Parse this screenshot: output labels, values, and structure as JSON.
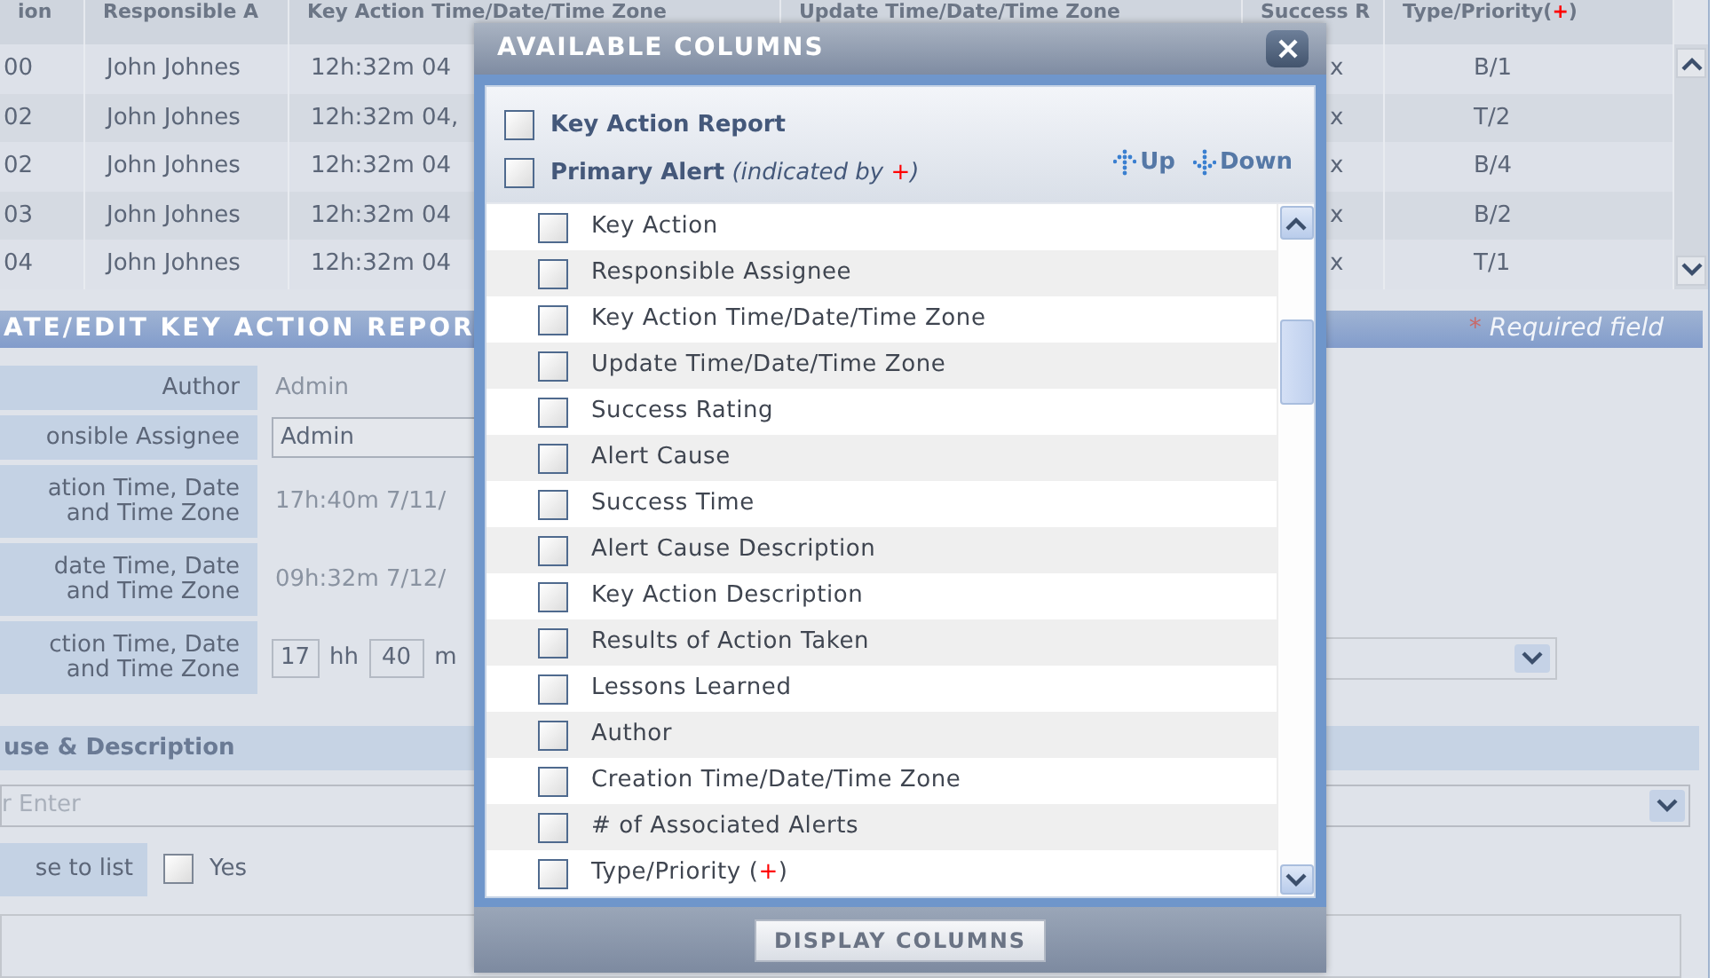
{
  "table": {
    "columns": [
      {
        "parts": [
          {
            "text": "ion"
          }
        ]
      },
      {
        "parts": [
          {
            "text": "Responsible A"
          }
        ]
      },
      {
        "parts": [
          {
            "text": "Key Action Time/Date/Time Zone"
          }
        ]
      },
      {
        "parts": [
          {
            "text": "Update Time/Date/Time Zone"
          }
        ]
      },
      {
        "parts": [
          {
            "text": "Success R"
          }
        ]
      },
      {
        "parts": [
          {
            "text": "Type/Priority("
          },
          {
            "text": "+",
            "color": "#ff0000"
          },
          {
            "text": ")"
          }
        ]
      }
    ],
    "rows": [
      {
        "cells": [
          "00",
          "John Johnes",
          "12h:32m 04",
          "",
          "x",
          "B/1"
        ]
      },
      {
        "cells": [
          "02",
          "John Johnes",
          "12h:32m 04,",
          "",
          "x",
          "T/2"
        ]
      },
      {
        "cells": [
          "02",
          "John Johnes",
          "12h:32m 04",
          "",
          "x",
          "B/4"
        ]
      },
      {
        "cells": [
          "03",
          "John Johnes",
          "12h:32m 04",
          "",
          "x",
          "B/2"
        ]
      },
      {
        "cells": [
          "04",
          "John Johnes",
          "12h:32m 04",
          "",
          "x",
          "T/1"
        ]
      }
    ]
  },
  "form": {
    "title": "ATE/EDIT KEY ACTION REPOR",
    "required_note": {
      "mark": "*",
      "text": "Required field"
    },
    "fields": [
      {
        "kind": "readonly",
        "label": "Author",
        "value": "Admin"
      },
      {
        "kind": "input",
        "label": "onsible Assignee",
        "value": "Admin"
      },
      {
        "kind": "readonly",
        "label": "ation Time, Date and Time Zone",
        "value": "17h:40m 7/11/"
      },
      {
        "kind": "readonly",
        "label": "date Time, Date and Time Zone",
        "value": "09h:32m 7/12/"
      },
      {
        "kind": "time",
        "label": "ction Time, Date and Time Zone",
        "hours": "17",
        "hours_unit": "hh",
        "minutes": "40",
        "minutes_unit": "m"
      }
    ],
    "section": "use & Description",
    "cause": {
      "placeholder": "r Enter"
    },
    "add_to_list": {
      "label": "se to list",
      "option": "Yes",
      "checked": false
    }
  },
  "dialog": {
    "title": "AVAILABLE COLUMNS",
    "groups": [
      {
        "checked": false,
        "parts": [
          {
            "text": "Key Action Report",
            "kind": "name"
          }
        ]
      },
      {
        "checked": false,
        "parts": [
          {
            "text": "Primary Alert",
            "kind": "name"
          },
          {
            "text": " (indicated by ",
            "kind": "note"
          },
          {
            "text": "+",
            "kind": "note",
            "color": "#ff0000"
          },
          {
            "text": ")",
            "kind": "note"
          }
        ]
      }
    ],
    "move_buttons": [
      {
        "kind": "up",
        "label": "Up"
      },
      {
        "kind": "down",
        "label": "Down"
      }
    ],
    "columns": [
      {
        "checked": false,
        "parts": [
          {
            "text": "Key Action"
          }
        ]
      },
      {
        "checked": false,
        "parts": [
          {
            "text": "Responsible Assignee"
          }
        ]
      },
      {
        "checked": false,
        "parts": [
          {
            "text": "Key Action Time/Date/Time Zone"
          }
        ]
      },
      {
        "checked": false,
        "parts": [
          {
            "text": "Update Time/Date/Time Zone"
          }
        ]
      },
      {
        "checked": false,
        "parts": [
          {
            "text": "Success Rating"
          }
        ]
      },
      {
        "checked": false,
        "parts": [
          {
            "text": "Alert Cause"
          }
        ]
      },
      {
        "checked": false,
        "parts": [
          {
            "text": "Success Time"
          }
        ]
      },
      {
        "checked": false,
        "parts": [
          {
            "text": "Alert Cause Description"
          }
        ]
      },
      {
        "checked": false,
        "parts": [
          {
            "text": "Key Action Description"
          }
        ]
      },
      {
        "checked": false,
        "parts": [
          {
            "text": "Results of Action Taken"
          }
        ]
      },
      {
        "checked": false,
        "parts": [
          {
            "text": "Lessons Learned"
          }
        ]
      },
      {
        "checked": false,
        "parts": [
          {
            "text": "Author"
          }
        ]
      },
      {
        "checked": false,
        "parts": [
          {
            "text": "Creation Time/Date/Time Zone"
          }
        ]
      },
      {
        "checked": false,
        "parts": [
          {
            "text": "# of Associated Alerts"
          }
        ]
      },
      {
        "checked": false,
        "parts": [
          {
            "text": "Type/Priority ("
          },
          {
            "text": "+",
            "color": "#ff0000"
          },
          {
            "text": ")"
          }
        ]
      }
    ],
    "submit": "DISPLAY COLUMNS"
  }
}
